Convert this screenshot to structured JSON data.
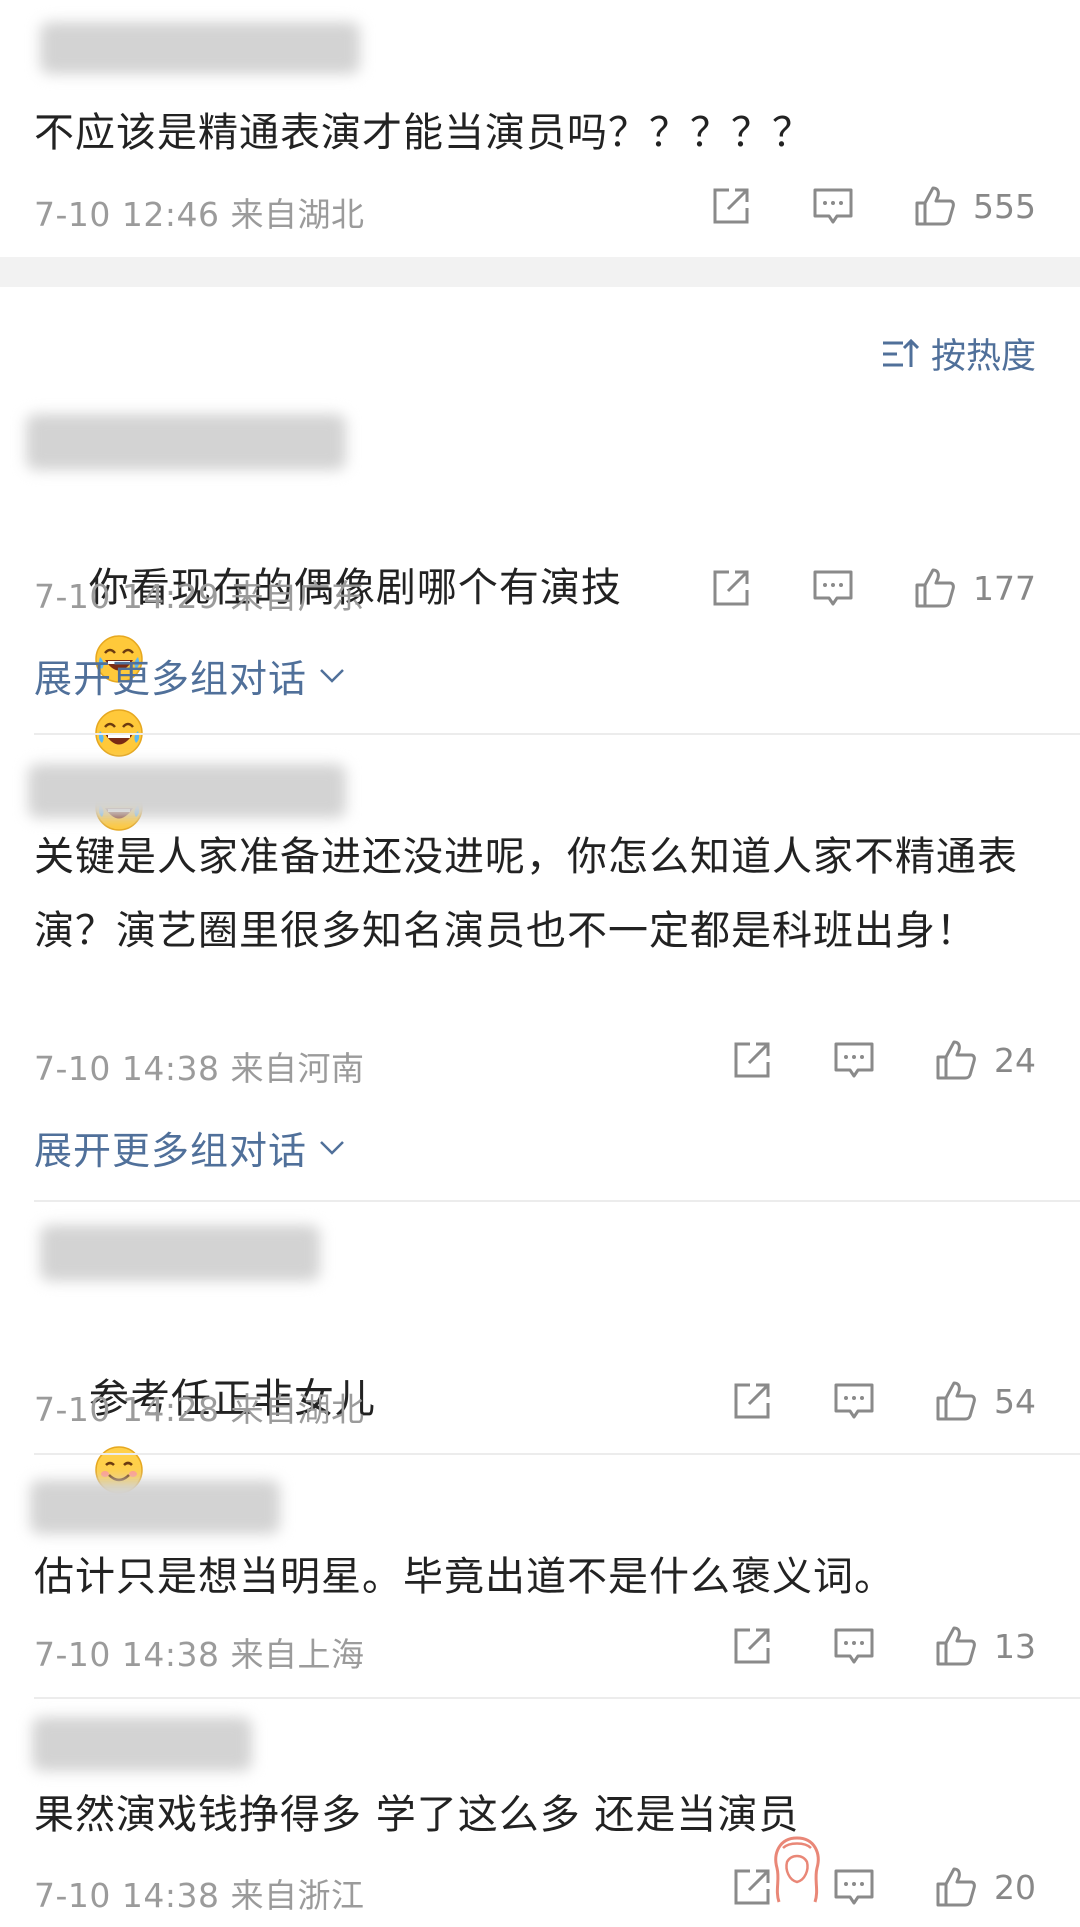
{
  "sort": {
    "label": "按热度"
  },
  "comments": [
    {
      "text": "不应该是精通表演才能当演员吗？？？？？",
      "time": "7-10 12:46",
      "location": "来自湖北",
      "likes": "555"
    },
    {
      "text": "你看现在的偶像剧哪个有演技",
      "emojis": [
        "laughing-crying-emoji",
        "laughing-crying-emoji",
        "laughing-crying-emoji"
      ],
      "time": "7-10 14:29",
      "location": "来自广东",
      "likes": "177",
      "expand_label": "展开更多组对话"
    },
    {
      "text": "关键是人家准备进还没进呢，你怎么知道人家不精通表演？演艺圈里很多知名演员也不一定都是科班出身！",
      "time": "7-10 14:38",
      "location": "来自河南",
      "likes": "24",
      "expand_label": "展开更多组对话"
    },
    {
      "text": "参考任正非女儿",
      "emojis": [
        "smiling-emoji"
      ],
      "time": "7-10 14:28",
      "location": "来自湖北",
      "likes": "54"
    },
    {
      "text": "估计只是想当明星。毕竟出道不是什么褒义词。",
      "time": "7-10 14:38",
      "location": "来自上海",
      "likes": "13"
    },
    {
      "text": "果然演戏钱挣得多 学了这么多 还是当演员",
      "time": "7-10 14:38",
      "location": "来自浙江",
      "likes": "20"
    }
  ],
  "colors": {
    "link": "#50709a",
    "meta": "#9b9b9b",
    "text": "#222222",
    "section_gap": "#f2f2f2"
  }
}
